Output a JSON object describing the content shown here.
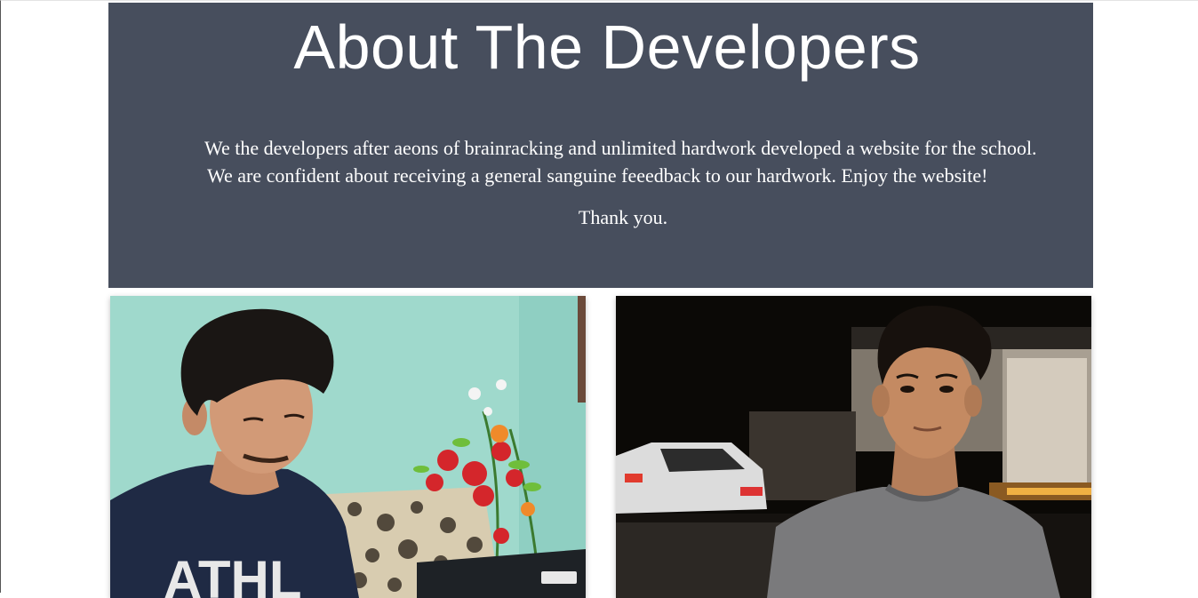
{
  "about": {
    "title": "About The Developers",
    "paragraph_line1": "We the developers after aeons of brainracking and unlimited hardwork developed a website for the school.",
    "paragraph_line2": "We are confident about receiving a general sanguine feeedback to our hardwork. Enjoy the website!",
    "thanks": "Thank you."
  },
  "colors": {
    "banner_bg": "#474e5d",
    "banner_text": "#ffffff",
    "page_bg": "#ffffff"
  },
  "developers": [
    {
      "photo_icon": "developer-photo-1"
    },
    {
      "photo_icon": "developer-photo-2"
    }
  ]
}
